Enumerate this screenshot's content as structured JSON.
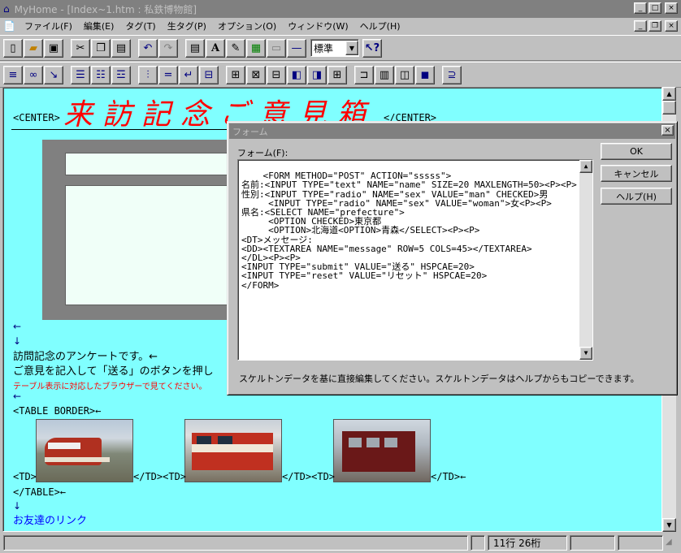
{
  "window": {
    "title": "MyHome - [Index~1.htm : 私鉄博物館]",
    "min": "_",
    "max": "□",
    "close": "×"
  },
  "mdi": {
    "min": "_",
    "restore": "❐",
    "close": "×"
  },
  "menu": [
    {
      "label": "ファイル(F)"
    },
    {
      "label": "編集(E)"
    },
    {
      "label": "タグ(T)"
    },
    {
      "label": "生タグ(P)"
    },
    {
      "label": "オプション(O)"
    },
    {
      "label": "ウィンドウ(W)"
    },
    {
      "label": "ヘルプ(H)"
    }
  ],
  "toolbar": {
    "style_value": "標準",
    "style_arrow": "▼"
  },
  "document": {
    "center_open": "<CENTER>",
    "heading": "来訪記念ご意見箱",
    "center_close": "</CENTER>",
    "arrow1": "←",
    "arrow2": "↓",
    "line1": "訪問記念のアンケートです。←",
    "line2": "ご意見を記入して「送る」のボタンを押し",
    "notice": "テーブル表示に対応したブラウザーで見てください。",
    "arrow3": "←",
    "table_border": "<TABLE BORDER>←",
    "td1": "<TD>",
    "td2": "</TD><TD>",
    "td3": "</TD><TD>",
    "td4": "</TD>←",
    "table_close": "</TABLE>←",
    "arrow4": "↓",
    "friend_link": "お友達のリンク"
  },
  "dialog": {
    "title": "フォーム",
    "label": "フォーム(F):",
    "code": "<FORM METHOD=\"POST\" ACTION=\"sssss\">\n名前:<INPUT TYPE=\"text\" NAME=\"name\" SIZE=20 MAXLENGTH=50><P><P>\n性別:<INPUT TYPE=\"radio\" NAME=\"sex\" VALUE=\"man\" CHECKED>男\n     <INPUT TYPE=\"radio\" NAME=\"sex\" VALUE=\"woman\">女<P><P>\n県名:<SELECT NAME=\"prefecture\">\n     <OPTION CHECKED>東京都\n     <OPTION>北海道<OPTION>青森</SELECT><P><P>\n<DT>メッセージ:\n<DD><TEXTAREA NAME=\"message\" ROW=5 COLS=45></TEXTAREA>\n</DL><P><P>\n<INPUT TYPE=\"submit\" VALUE=\"送る\" HSPCAE=20>\n<INPUT TYPE=\"reset\" VALUE=\"リセット\" HSPCAE=20>\n</FORM>",
    "ok": "OK",
    "cancel": "キャンセル",
    "help": "ヘルプ(H)",
    "hint": "スケルトンデータを基に直接編集してください。スケルトンデータはヘルプからもコピーできます。",
    "close": "×"
  },
  "status": {
    "position": "11行  26桁"
  }
}
